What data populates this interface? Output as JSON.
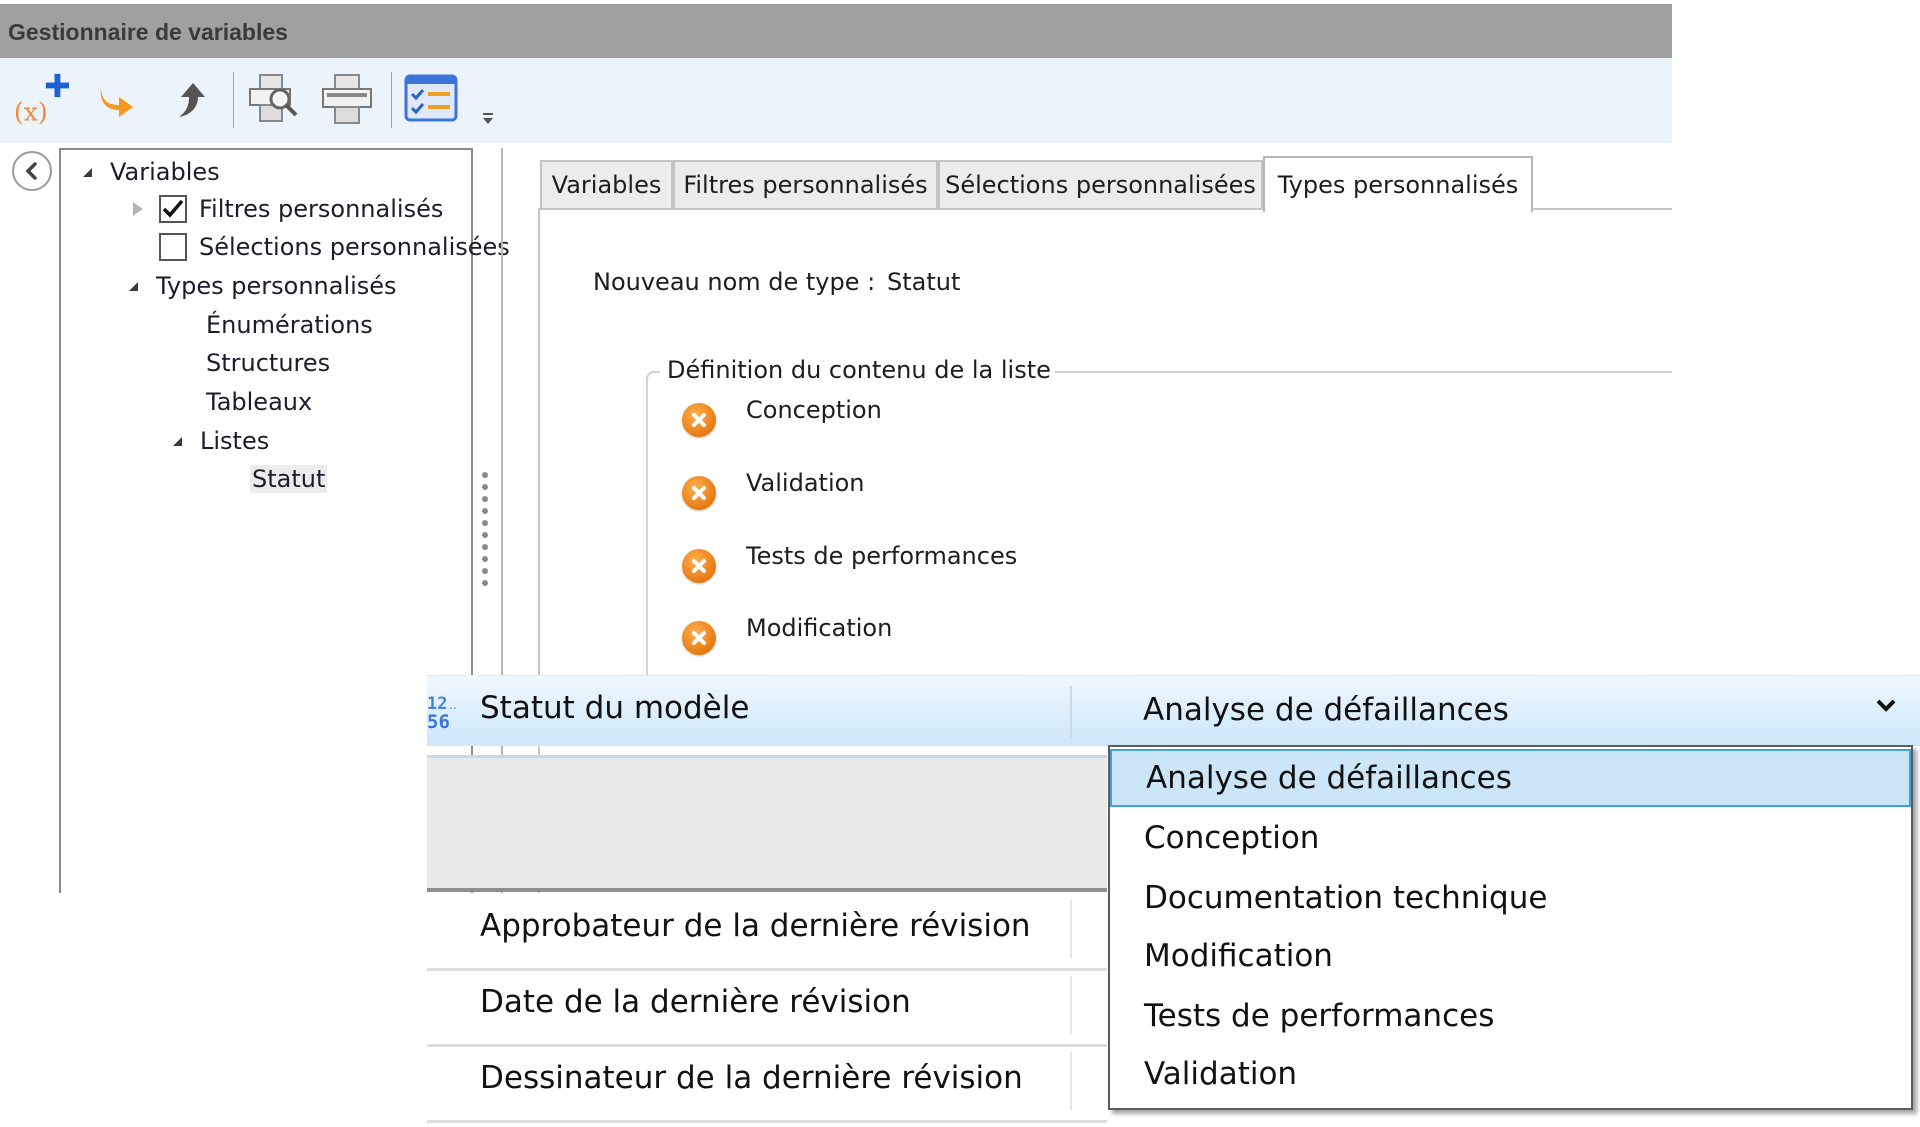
{
  "window": {
    "title": "Gestionnaire de variables"
  },
  "toolbar": {
    "buttons": [
      {
        "icon": "add-variable-icon",
        "tooltip": ""
      },
      {
        "icon": "redirect-arrow-icon",
        "tooltip": ""
      },
      {
        "icon": "up-arrow-icon",
        "tooltip": ""
      },
      {
        "icon": "print-preview-icon",
        "tooltip": ""
      },
      {
        "icon": "print-icon",
        "tooltip": ""
      },
      {
        "icon": "checklist-icon",
        "tooltip": ""
      },
      {
        "icon": "overflow-menu-icon",
        "tooltip": ""
      }
    ]
  },
  "tree": {
    "root": "Variables",
    "items": [
      {
        "label": "Filtres personnalisés",
        "checked": true,
        "expandable": true
      },
      {
        "label": "Sélections personnalisées",
        "checked": false
      },
      {
        "label": "Types personnalisés",
        "expanded": true
      },
      {
        "label": "Énumérations"
      },
      {
        "label": "Structures"
      },
      {
        "label": "Tableaux"
      },
      {
        "label": "Listes",
        "expanded": true
      },
      {
        "label": "Statut",
        "selected": true
      }
    ]
  },
  "tabs": [
    {
      "label": "Variables",
      "active": false
    },
    {
      "label": "Filtres personnalisés",
      "active": false
    },
    {
      "label": "Sélections personnalisées",
      "active": false
    },
    {
      "label": "Types personnalisés",
      "active": true
    }
  ],
  "types_panel": {
    "new_type_label": "Nouveau nom de type :",
    "new_type_value": "Statut",
    "group_title": "Définition du contenu de la liste",
    "list_items": [
      "Conception",
      "Validation",
      "Tests de performances",
      "Modification"
    ]
  },
  "property_grid": {
    "status_row": {
      "label": "Statut du modèle",
      "icon": "list-type-icon",
      "value": "Analyse de défaillances"
    },
    "rows": [
      {
        "label": "Approbateur de la dernière révision"
      },
      {
        "label": "Date de la dernière révision"
      },
      {
        "label": "Dessinateur de la dernière révision"
      }
    ],
    "dropdown_options": [
      "Analyse de défaillances",
      "Conception",
      "Documentation technique",
      "Modification",
      "Tests de performances",
      "Validation"
    ],
    "selected_index": 0
  },
  "colors": {
    "titlebar": "#a0a0a0",
    "toolbar": "#edf3fb",
    "selection": "#cde6f7",
    "selection_border": "#3f9fe0",
    "delete_icon": "#e87912"
  }
}
